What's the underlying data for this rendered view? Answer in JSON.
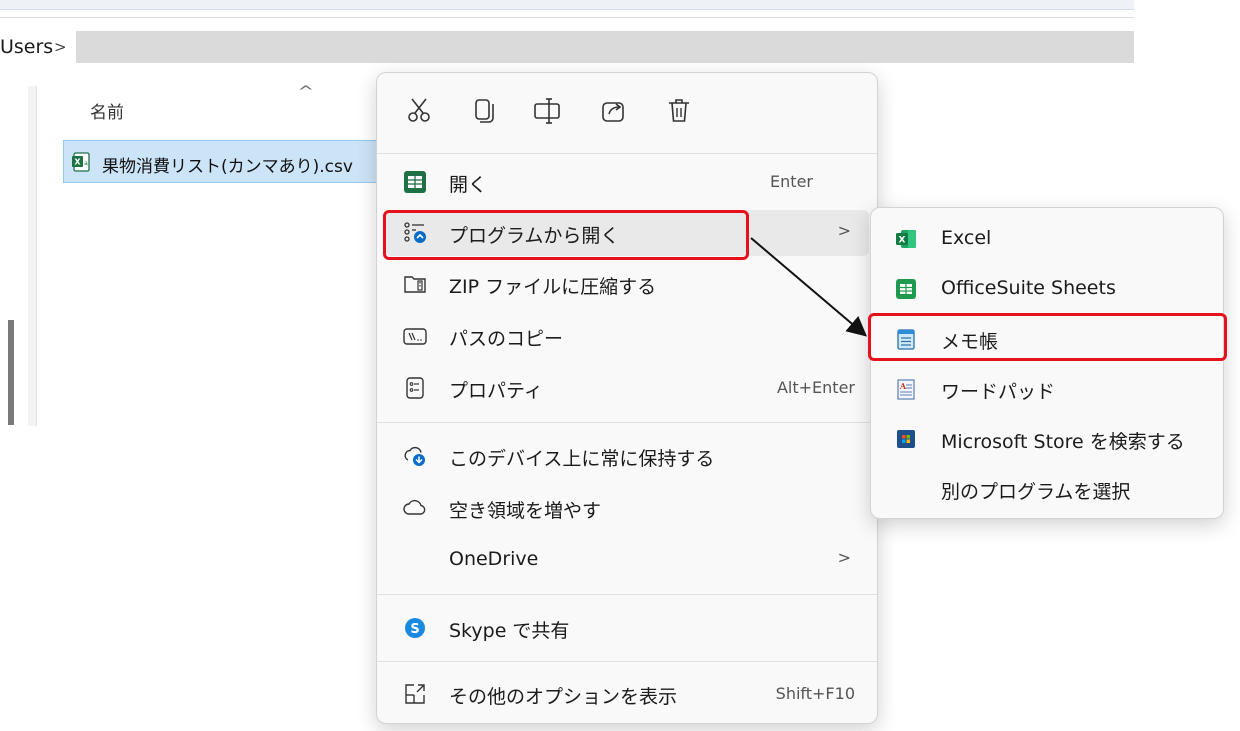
{
  "explorer": {
    "breadcrumb_text": "Users",
    "breadcrumb_chevron": ">",
    "column_name": "名前",
    "file_name": "果物消費リスト(カンマあり).csv"
  },
  "quick_actions": [
    "cut-icon",
    "copy-icon",
    "rename-icon",
    "share-icon",
    "delete-icon"
  ],
  "menu": {
    "open": {
      "label": "開く",
      "shortcut": "Enter"
    },
    "open_with": {
      "label": "プログラムから開く",
      "chevron": ">"
    },
    "zip": {
      "label": "ZIP ファイルに圧縮する"
    },
    "copy_path": {
      "label": "パスのコピー"
    },
    "properties": {
      "label": "プロパティ",
      "shortcut": "Alt+Enter"
    },
    "keep_on_device": {
      "label": "このデバイス上に常に保持する"
    },
    "free_space": {
      "label": "空き領域を増やす"
    },
    "onedrive": {
      "label": "OneDrive",
      "chevron": ">"
    },
    "skype": {
      "label": "Skype で共有"
    },
    "more_options": {
      "label": "その他のオプションを表示",
      "shortcut": "Shift+F10"
    }
  },
  "submenu": {
    "excel": "Excel",
    "officesuite": "OfficeSuite Sheets",
    "notepad": "メモ帳",
    "wordpad": "ワードパッド",
    "store": "Microsoft Store を検索する",
    "choose_other": "別のプログラムを選択"
  },
  "colors": {
    "highlight": "#e5121e",
    "selection": "#cce4f7",
    "excel_green": "#1e7145",
    "accent_blue": "#0a6cc7"
  }
}
